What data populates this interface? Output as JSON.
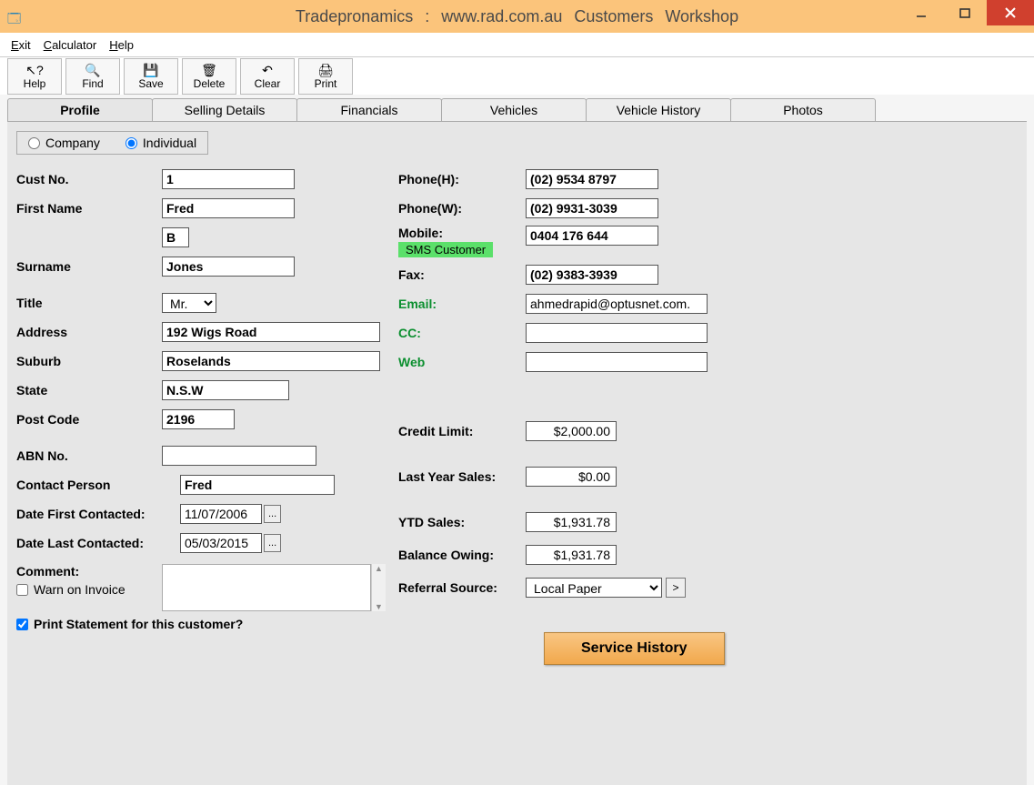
{
  "window": {
    "title": "Tradepronamics :   www.rad.com.au     Customers    Workshop"
  },
  "menu": {
    "exit": "Exit",
    "calculator": "Calculator",
    "help": "Help"
  },
  "toolbar": {
    "help": "Help",
    "find": "Find",
    "save": "Save",
    "delete": "Delete",
    "clear": "Clear",
    "print": "Print"
  },
  "tabs": [
    "Profile",
    "Selling Details",
    "Financials",
    "Vehicles",
    "Vehicle History",
    "Photos"
  ],
  "type": {
    "company": "Company",
    "individual": "Individual",
    "selected": "individual"
  },
  "labels": {
    "custno": "Cust No.",
    "firstname": "First Name",
    "surname": "Surname",
    "title": "Title",
    "address": "Address",
    "suburb": "Suburb",
    "state": "State",
    "postcode": "Post Code",
    "abn": "ABN No.",
    "contact": "Contact Person",
    "datefirst": "Date First Contacted:",
    "datelast": "Date Last Contacted:",
    "comment": "Comment:",
    "warn": "Warn on Invoice",
    "printstmt": "Print Statement for this customer?",
    "phoneh": "Phone(H):",
    "phonew": "Phone(W):",
    "mobile": "Mobile:",
    "sms": "SMS Customer",
    "fax": "Fax:",
    "email": "Email:",
    "cc": "CC:",
    "web": "Web",
    "creditlimit": "Credit Limit:",
    "lastyear": "Last Year Sales:",
    "ytd": "YTD Sales:",
    "balance": "Balance Owing:",
    "referral": "Referral Source:",
    "svchist": "Service History"
  },
  "values": {
    "custno": "1",
    "firstname": "Fred",
    "initial": "B",
    "surname": "Jones",
    "title": "Mr.",
    "address": "192 Wigs Road",
    "suburb": "Roselands",
    "state": "N.S.W",
    "postcode": "2196",
    "abn": "",
    "contact": "Fred",
    "datefirst": "11/07/2006",
    "datelast": "05/03/2015",
    "phoneh": "(02) 9534 8797",
    "phonew": "(02) 9931-3039",
    "mobile": "0404 176 644",
    "fax": "(02) 9383-3939",
    "email": "ahmedrapid@optusnet.com.",
    "cc": "",
    "web": "",
    "creditlimit": "$2,000.00",
    "lastyear": "$0.00",
    "ytd": "$1,931.78",
    "balance": "$1,931.78",
    "referral": "Local Paper"
  }
}
